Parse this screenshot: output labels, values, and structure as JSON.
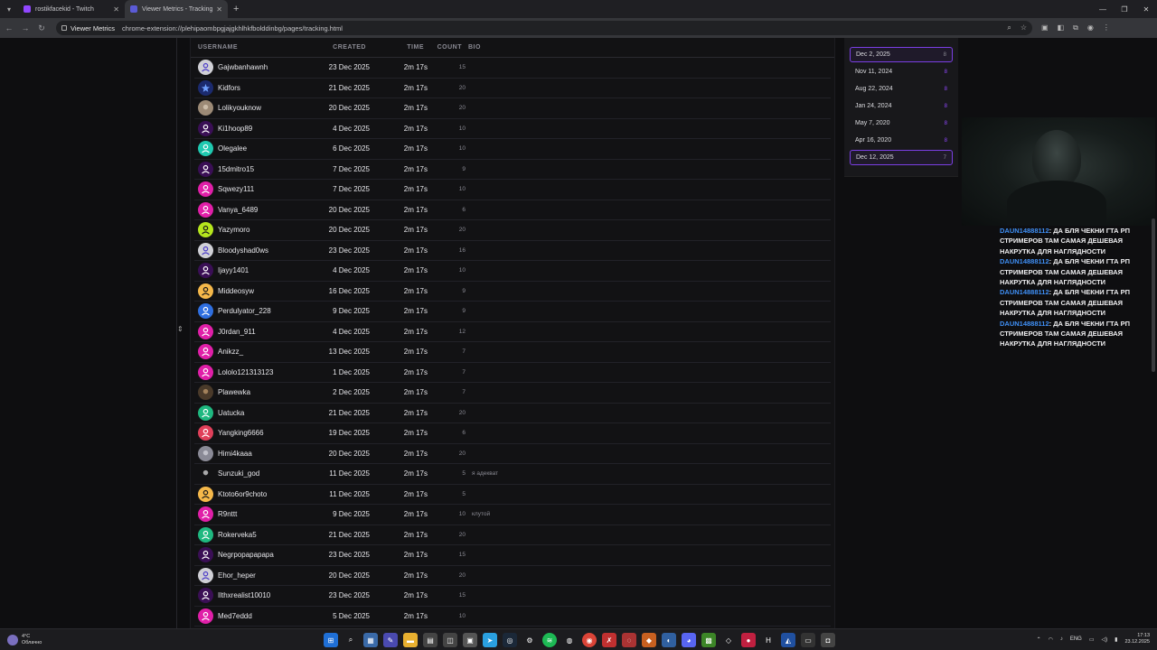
{
  "browser": {
    "tabs": [
      {
        "title": "rostikfacekid - Twitch",
        "favicon_color": "#9147ff"
      },
      {
        "title": "Viewer Metrics - Tracking",
        "favicon_color": "#5b5bd6"
      }
    ],
    "site_chip": "Viewer Metrics",
    "url": "chrome-extension://plehipaombpgjajgkhlhkfbolddinbg/pages/tracking.html"
  },
  "table": {
    "headers": {
      "username": "USERNAME",
      "created": "CREATED",
      "time": "TIME",
      "count": "COUNT",
      "bio": "BIO"
    },
    "rows": [
      {
        "username": "Gajwbanhawnh",
        "created": "23 Dec 2025",
        "time": "2m 17s",
        "count": "15",
        "bio": "",
        "avatar_bg": "#d0d0d6",
        "avatar_fg": "#4b3cc8",
        "avatar_kind": "default"
      },
      {
        "username": "Kidfors",
        "created": "21 Dec 2025",
        "time": "2m 17s",
        "count": "20",
        "bio": "",
        "avatar_bg": "#1b2a6e",
        "avatar_fg": "#6fa0ff",
        "avatar_kind": "star"
      },
      {
        "username": "Lolikyouknow",
        "created": "20 Dec 2025",
        "time": "2m 17s",
        "count": "20",
        "bio": "",
        "avatar_bg": "#9c8a76",
        "avatar_fg": "#e0d2bf",
        "avatar_kind": "photo"
      },
      {
        "username": "Ki1hoop89",
        "created": "4 Dec 2025",
        "time": "2m 17s",
        "count": "10",
        "bio": "",
        "avatar_bg": "#3a0f55",
        "avatar_fg": "#ffffff",
        "avatar_kind": "default"
      },
      {
        "username": "Olegalee",
        "created": "6 Dec 2025",
        "time": "2m 17s",
        "count": "10",
        "bio": "",
        "avatar_bg": "#1fc9b0",
        "avatar_fg": "#ffffff",
        "avatar_kind": "default"
      },
      {
        "username": "15dmitro15",
        "created": "7 Dec 2025",
        "time": "2m 17s",
        "count": "9",
        "bio": "",
        "avatar_bg": "#3a0f55",
        "avatar_fg": "#ffffff",
        "avatar_kind": "default"
      },
      {
        "username": "Sqwezy111",
        "created": "7 Dec 2025",
        "time": "2m 17s",
        "count": "10",
        "bio": "",
        "avatar_bg": "#e01fa8",
        "avatar_fg": "#ffffff",
        "avatar_kind": "default"
      },
      {
        "username": "Vanya_6489",
        "created": "20 Dec 2025",
        "time": "2m 17s",
        "count": "6",
        "bio": "",
        "avatar_bg": "#e01fa8",
        "avatar_fg": "#ffffff",
        "avatar_kind": "default"
      },
      {
        "username": "Yazymoro",
        "created": "20 Dec 2025",
        "time": "2m 17s",
        "count": "20",
        "bio": "",
        "avatar_bg": "#b5e61d",
        "avatar_fg": "#1a1a1a",
        "avatar_kind": "default"
      },
      {
        "username": "Bloodyshad0ws",
        "created": "23 Dec 2025",
        "time": "2m 17s",
        "count": "16",
        "bio": "",
        "avatar_bg": "#d0d0d6",
        "avatar_fg": "#4b3cc8",
        "avatar_kind": "default"
      },
      {
        "username": "Ijayy1401",
        "created": "4 Dec 2025",
        "time": "2m 17s",
        "count": "10",
        "bio": "",
        "avatar_bg": "#3a0f55",
        "avatar_fg": "#ffffff",
        "avatar_kind": "default"
      },
      {
        "username": "Middeosyw",
        "created": "16 Dec 2025",
        "time": "2m 17s",
        "count": "9",
        "bio": "",
        "avatar_bg": "#f5b84a",
        "avatar_fg": "#1a1a1a",
        "avatar_kind": "default"
      },
      {
        "username": "Perdulyator_228",
        "created": "9 Dec 2025",
        "time": "2m 17s",
        "count": "9",
        "bio": "",
        "avatar_bg": "#2f6fe0",
        "avatar_fg": "#ffffff",
        "avatar_kind": "default"
      },
      {
        "username": "J0rdan_911",
        "created": "4 Dec 2025",
        "time": "2m 17s",
        "count": "12",
        "bio": "",
        "avatar_bg": "#e01fa8",
        "avatar_fg": "#ffffff",
        "avatar_kind": "default"
      },
      {
        "username": "Anikzz_",
        "created": "13 Dec 2025",
        "time": "2m 17s",
        "count": "7",
        "bio": "",
        "avatar_bg": "#e01fa8",
        "avatar_fg": "#ffffff",
        "avatar_kind": "default"
      },
      {
        "username": "Lololo121313123",
        "created": "1 Dec 2025",
        "time": "2m 17s",
        "count": "7",
        "bio": "",
        "avatar_bg": "#e01fa8",
        "avatar_fg": "#ffffff",
        "avatar_kind": "default"
      },
      {
        "username": "Plawewka",
        "created": "2 Dec 2025",
        "time": "2m 17s",
        "count": "7",
        "bio": "",
        "avatar_bg": "#4a3a2a",
        "avatar_fg": "#c8a070",
        "avatar_kind": "photo"
      },
      {
        "username": "Uatucka",
        "created": "21 Dec 2025",
        "time": "2m 17s",
        "count": "20",
        "bio": "",
        "avatar_bg": "#1fb880",
        "avatar_fg": "#ffffff",
        "avatar_kind": "default"
      },
      {
        "username": "Yangking6666",
        "created": "19 Dec 2025",
        "time": "2m 17s",
        "count": "6",
        "bio": "",
        "avatar_bg": "#e0405a",
        "avatar_fg": "#ffffff",
        "avatar_kind": "default"
      },
      {
        "username": "Himi4kaaa",
        "created": "20 Dec 2025",
        "time": "2m 17s",
        "count": "20",
        "bio": "",
        "avatar_bg": "#8a8a96",
        "avatar_fg": "#d8d8e0",
        "avatar_kind": "photo"
      },
      {
        "username": "Sunzuki_god",
        "created": "11 Dec 2025",
        "time": "2m 17s",
        "count": "5",
        "bio": "я адекват",
        "avatar_bg": "#121214",
        "avatar_fg": "#e8e8e8",
        "avatar_kind": "photo"
      },
      {
        "username": "Ktoto6or9choto",
        "created": "11 Dec 2025",
        "time": "2m 17s",
        "count": "5",
        "bio": "",
        "avatar_bg": "#f5b84a",
        "avatar_fg": "#1a1a1a",
        "avatar_kind": "default"
      },
      {
        "username": "R9nttt",
        "created": "9 Dec 2025",
        "time": "2m 17s",
        "count": "10",
        "bio": "клутой",
        "avatar_bg": "#e01fa8",
        "avatar_fg": "#ffffff",
        "avatar_kind": "default"
      },
      {
        "username": "Rokerveka5",
        "created": "21 Dec 2025",
        "time": "2m 17s",
        "count": "20",
        "bio": "",
        "avatar_bg": "#1fb880",
        "avatar_fg": "#ffffff",
        "avatar_kind": "default"
      },
      {
        "username": "Negrpopapapapa",
        "created": "23 Dec 2025",
        "time": "2m 17s",
        "count": "15",
        "bio": "",
        "avatar_bg": "#3a0f55",
        "avatar_fg": "#ffffff",
        "avatar_kind": "default"
      },
      {
        "username": "Ehor_heper",
        "created": "20 Dec 2025",
        "time": "2m 17s",
        "count": "20",
        "bio": "",
        "avatar_bg": "#d0d0d6",
        "avatar_fg": "#4b3cc8",
        "avatar_kind": "default"
      },
      {
        "username": "Ilthxrealist10010",
        "created": "23 Dec 2025",
        "time": "2m 17s",
        "count": "15",
        "bio": "",
        "avatar_bg": "#3a0f55",
        "avatar_fg": "#ffffff",
        "avatar_kind": "default"
      },
      {
        "username": "Med7eddd",
        "created": "5 Dec 2025",
        "time": "2m 17s",
        "count": "10",
        "bio": "",
        "avatar_bg": "#e01fa8",
        "avatar_fg": "#ffffff",
        "avatar_kind": "default"
      }
    ]
  },
  "dates": {
    "items": [
      {
        "label": "Dec 2, 2025",
        "count": "8",
        "selected": true
      },
      {
        "label": "Nov 11, 2024",
        "count": "8",
        "selected": false
      },
      {
        "label": "Aug 22, 2024",
        "count": "8",
        "selected": false
      },
      {
        "label": "Jan 24, 2024",
        "count": "8",
        "selected": false
      },
      {
        "label": "May 7, 2020",
        "count": "8",
        "selected": false
      },
      {
        "label": "Apr 16, 2020",
        "count": "8",
        "selected": false
      },
      {
        "label": "Dec 12, 2025",
        "count": "7",
        "selected": true
      }
    ]
  },
  "chat": {
    "messages": [
      {
        "nick": "DAUN14888112",
        "text": "ДА БЛЯ ЧЕКНИ ГТА РП СТРИМЕРОВ ТАМ САМАЯ ДЕШЕВАЯ НАКРУТКА ДЛЯ НАГЛЯДНОСТИ"
      },
      {
        "nick": "DAUN14888112",
        "text": "ДА БЛЯ ЧЕКНИ ГТА РП СТРИМЕРОВ ТАМ САМАЯ ДЕШЕВАЯ НАКРУТКА ДЛЯ НАГЛЯДНОСТИ"
      },
      {
        "nick": "DAUN14888112",
        "text": "ДА БЛЯ ЧЕКНИ ГТА РП СТРИМЕРОВ ТАМ САМАЯ ДЕШЕВАЯ НАКРУТКА ДЛЯ НАГЛЯДНОСТИ"
      },
      {
        "nick": "DAUN14888112",
        "text": "ДА БЛЯ ЧЕКНИ ГТА РП СТРИМЕРОВ ТАМ САМАЯ ДЕШЕВАЯ НАКРУТКА ДЛЯ НАГЛЯДНОСТИ"
      }
    ]
  },
  "taskbar": {
    "weather_temp": "4°C",
    "weather_desc": "Облачно",
    "lang": "ENG",
    "time": "17:13",
    "date": "23.12.2025"
  }
}
